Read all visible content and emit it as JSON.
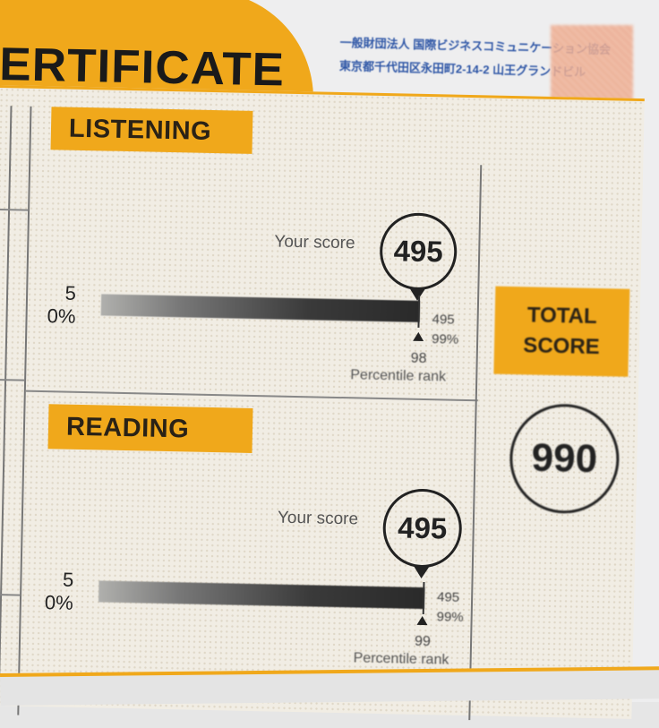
{
  "certificate": {
    "title_fragment": "ERTIFICATE"
  },
  "issuer": {
    "org_line": "一般財団法人 国際ビジネスコミュニケーション協会",
    "address_line": "東京都千代田区永田町2-14-2 山王グランドビル"
  },
  "listening": {
    "section_label": "LISTENING",
    "your_score_label": "Your score",
    "score": "495",
    "scale_min_score": "5",
    "scale_min_pct": "0%",
    "scale_max_score": "495",
    "scale_max_pct": "99%",
    "percentile_rank": "98",
    "percentile_label": "Percentile rank",
    "bar_level_pct": 100
  },
  "reading": {
    "section_label": "READING",
    "your_score_label": "Your score",
    "score": "495",
    "scale_min_score": "5",
    "scale_min_pct": "0%",
    "scale_max_score": "495",
    "scale_max_pct": "99%",
    "percentile_rank": "99",
    "percentile_label": "Percentile rank",
    "bar_level_pct": 100
  },
  "total": {
    "label_line1": "TOTAL",
    "label_line2": "SCORE",
    "score": "990"
  },
  "colors": {
    "accent_orange": "#f0a81b",
    "ink": "#222222",
    "issuer_blue": "#2e56a6",
    "seal_red": "#eaa68a"
  }
}
